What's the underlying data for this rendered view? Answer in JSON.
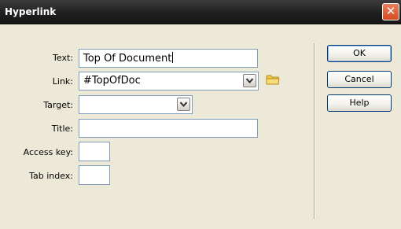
{
  "window": {
    "title": "Hyperlink",
    "close_glyph": "✕"
  },
  "form": {
    "text_label": "Text:",
    "text_value": "Top Of Document",
    "link_label": "Link:",
    "link_value": "#TopOfDoc",
    "target_label": "Target:",
    "target_value": "",
    "title_label": "Title:",
    "title_value": "",
    "access_key_label": "Access key:",
    "access_key_value": "",
    "tab_index_label": "Tab index:",
    "tab_index_value": ""
  },
  "buttons": {
    "ok": "OK",
    "cancel": "Cancel",
    "help": "Help"
  },
  "icons": {
    "close": "close-icon",
    "browse": "folder-icon",
    "dropdown": "chevron-down-icon"
  },
  "colors": {
    "titlebar": "#1f1f1f",
    "close_button": "#d44a1c",
    "dialog_bg": "#ece9d8",
    "folder": "#f2c94c"
  }
}
